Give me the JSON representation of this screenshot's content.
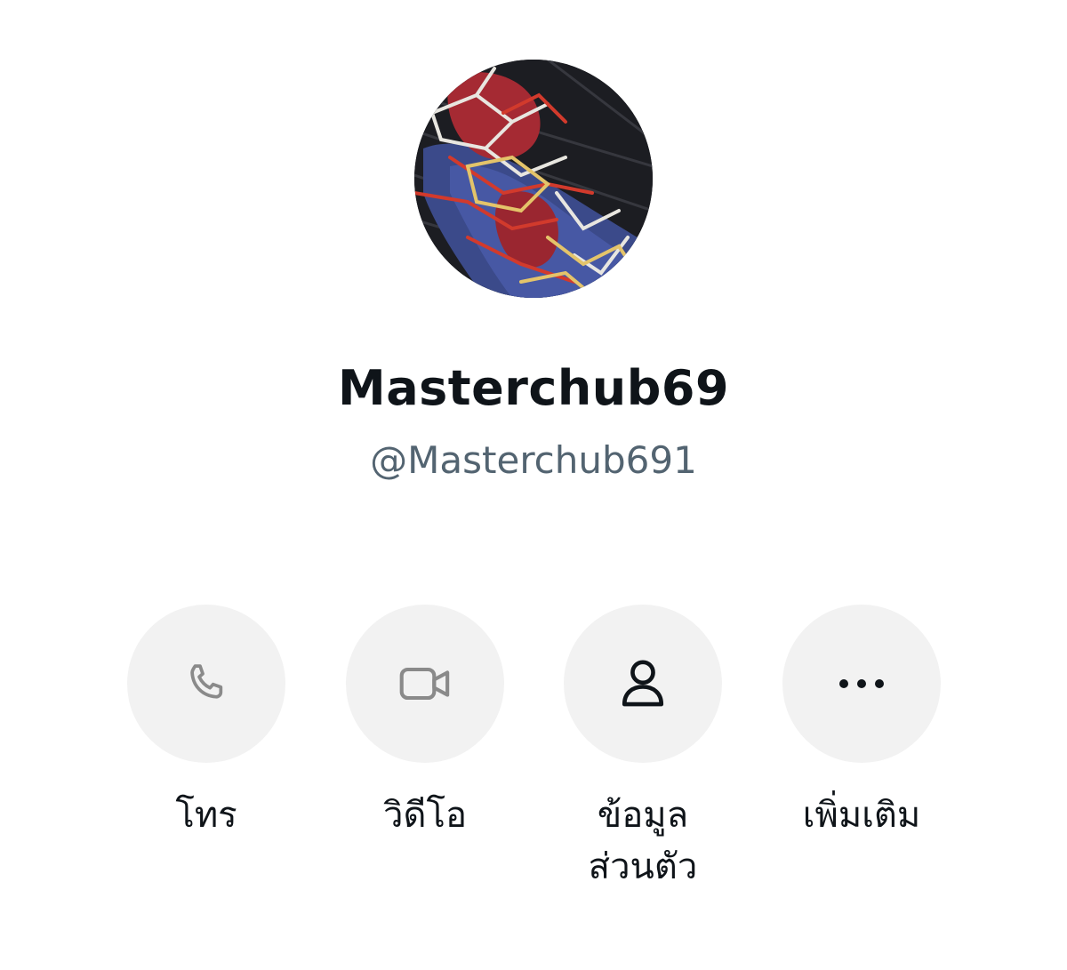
{
  "profile": {
    "display_name": "Masterchub69",
    "handle": "@Masterchub691"
  },
  "actions": [
    {
      "label": "โทร",
      "icon": "phone-icon",
      "enabled": false
    },
    {
      "label": "วิดีโอ",
      "icon": "video-camera-icon",
      "enabled": false
    },
    {
      "label": "ข้อมูล\nส่วนตัว",
      "icon": "person-icon",
      "enabled": true
    },
    {
      "label": "เพิ่มเติม",
      "icon": "more-dots-icon",
      "enabled": true
    }
  ],
  "colors": {
    "button_bg": "#f2f2f2",
    "disabled_icon": "#8a8a8a",
    "enabled_icon": "#0f1419",
    "name": "#0f1419",
    "handle": "#536471"
  }
}
